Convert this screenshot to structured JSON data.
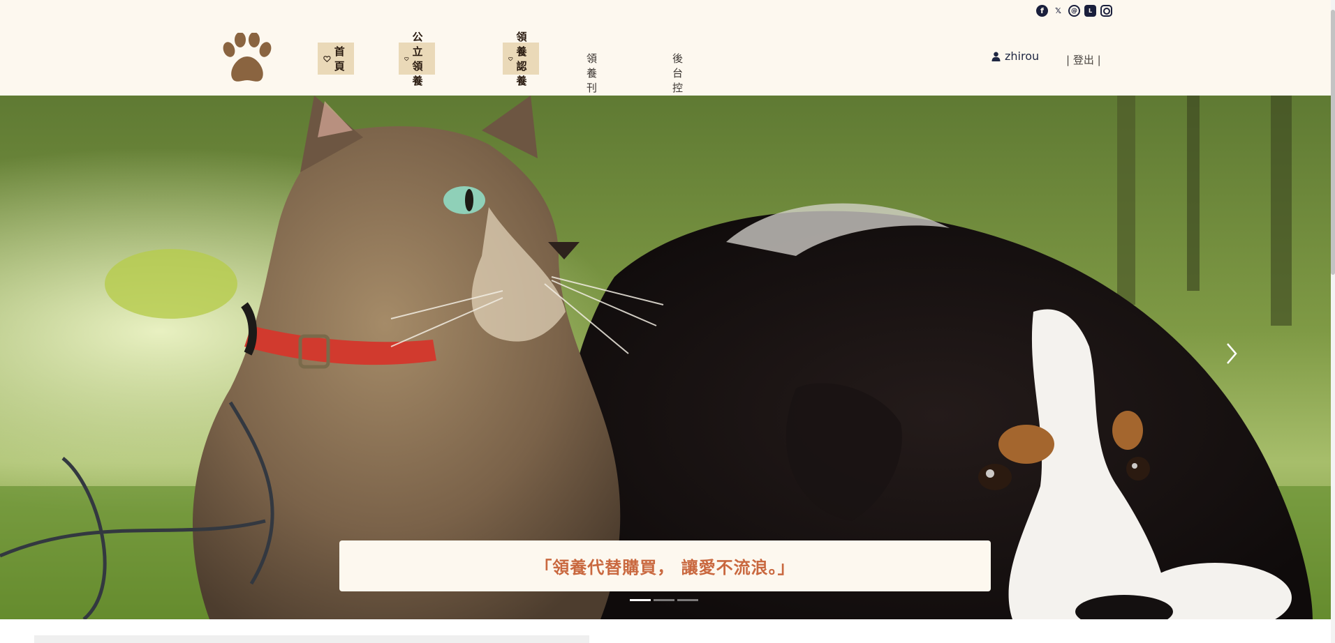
{
  "header": {
    "social_icons": [
      "facebook-icon",
      "x-icon",
      "threads-icon",
      "line-icon",
      "instagram-icon"
    ],
    "social_glyphs": {
      "facebook": "f",
      "x": "𝕏",
      "threads": "@",
      "line": "L"
    },
    "nav": {
      "home": "首頁",
      "public_adoption": "公立領養",
      "adopt": "領養認養",
      "publish_manage": "領養刊登管理",
      "admin": "後台控制"
    },
    "user": {
      "name": "zhirou"
    },
    "logout": "| 登出 |"
  },
  "hero": {
    "slogan": "「領養代替購買， 讓愛不流浪。」",
    "slide_count": 3,
    "active_slide": 1
  },
  "colors": {
    "header_bg": "#fdf8ef",
    "nav_button_bg": "#ead9b8",
    "logo": "#8a6440",
    "slogan": "#c9683f"
  }
}
